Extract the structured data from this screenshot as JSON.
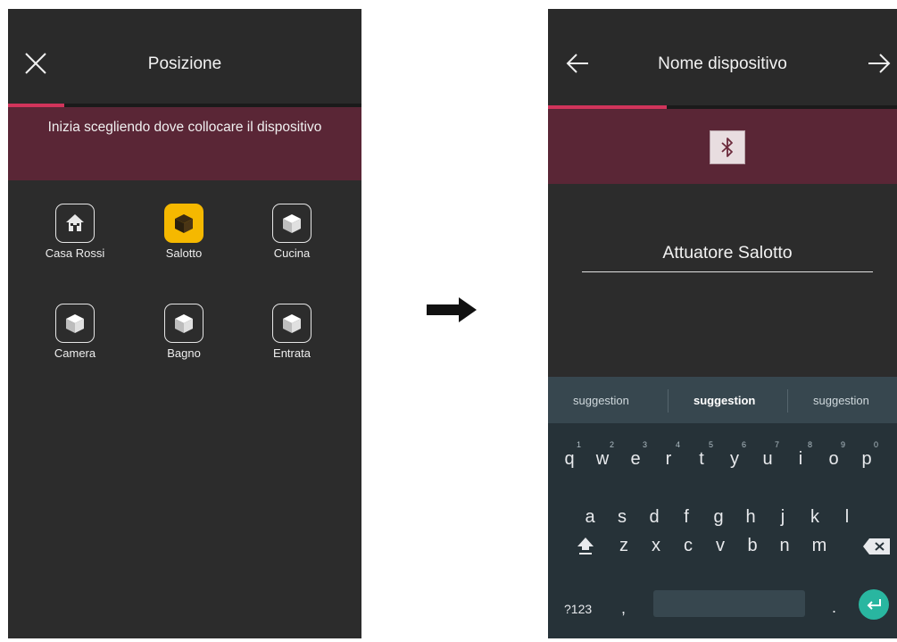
{
  "left_screen": {
    "title": "Posizione",
    "progress": 0.16,
    "banner_text": "Inizia scegliendo dove collocare il dispositivo",
    "rooms": [
      {
        "label": "Casa Rossi",
        "icon": "house-icon",
        "selected": false
      },
      {
        "label": "Salotto",
        "icon": "cube-icon",
        "selected": true
      },
      {
        "label": "Cucina",
        "icon": "cube-icon",
        "selected": false
      },
      {
        "label": "Camera",
        "icon": "cube-icon",
        "selected": false
      },
      {
        "label": "Bagno",
        "icon": "cube-icon",
        "selected": false
      },
      {
        "label": "Entrata",
        "icon": "cube-icon",
        "selected": false
      }
    ]
  },
  "right_screen": {
    "title": "Nome dispositivo",
    "progress": 0.34,
    "device_name": "Attuatore Salotto",
    "suggestions": [
      "suggestion",
      "suggestion",
      "suggestion"
    ],
    "keyboard": {
      "row1": [
        "q",
        "w",
        "e",
        "r",
        "t",
        "y",
        "u",
        "i",
        "o",
        "p"
      ],
      "row1_hints": [
        "1",
        "2",
        "3",
        "4",
        "5",
        "6",
        "7",
        "8",
        "9",
        "0"
      ],
      "row2": [
        "a",
        "s",
        "d",
        "f",
        "g",
        "h",
        "j",
        "k",
        "l"
      ],
      "row3": [
        "z",
        "x",
        "c",
        "v",
        "b",
        "n",
        "m"
      ],
      "symbols_label": "?123",
      "comma": ",",
      "period": "."
    }
  },
  "colors": {
    "screen_bg": "#2c2c2c",
    "banner": "#5a2636",
    "accent": "#d1345b",
    "selected_tile": "#f5b800",
    "keyboard_bg": "#263238",
    "enter_key": "#29b6a0"
  }
}
